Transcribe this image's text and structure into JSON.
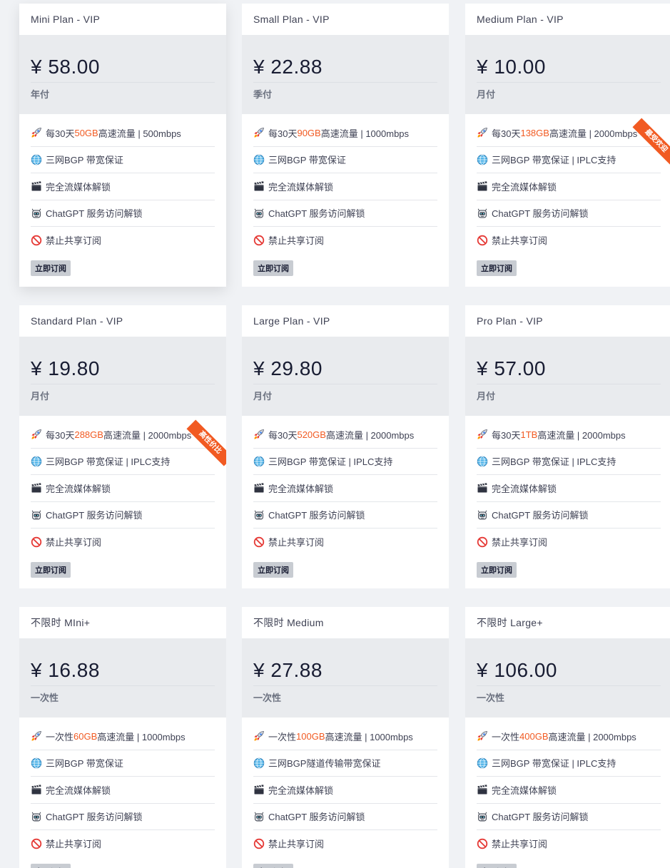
{
  "feature_icons": [
    "rocket-icon",
    "globe-icon",
    "clapper-icon",
    "robot-icon",
    "prohibited-icon"
  ],
  "subscribe_label": "立即订阅",
  "plans": [
    {
      "name": "Mini Plan - VIP",
      "price": "¥ 58.00",
      "period": "年付",
      "traffic": {
        "pre": "每30天",
        "hl": "50GB",
        "post": "高速流量 | 500mbps"
      },
      "features": [
        "三网BGP 带宽保证",
        "完全流媒体解锁",
        "ChatGPT 服务访问解锁",
        "禁止共享订阅"
      ]
    },
    {
      "name": "Small Plan - VIP",
      "price": "¥ 22.88",
      "period": "季付",
      "traffic": {
        "pre": "每30天",
        "hl": "90GB",
        "post": "高速流量 | 1000mbps"
      },
      "features": [
        "三网BGP 带宽保证",
        "完全流媒体解锁",
        "ChatGPT 服务访问解锁",
        "禁止共享订阅"
      ]
    },
    {
      "name": "Medium Plan - VIP",
      "price": "¥ 10.00",
      "period": "月付",
      "traffic": {
        "pre": "每30天",
        "hl": "138GB",
        "post": "高速流量 | 2000mbps"
      },
      "features": [
        "三网BGP 带宽保证 | IPLC支持",
        "完全流媒体解锁",
        "ChatGPT 服务访问解锁",
        "禁止共享订阅"
      ],
      "ribbon": "最受欢迎"
    },
    {
      "name": "Standard Plan - VIP",
      "price": "¥ 19.80",
      "period": "月付",
      "traffic": {
        "pre": "每30天",
        "hl": "288GB",
        "post": "高速流量 | 2000mbps"
      },
      "features": [
        "三网BGP 带宽保证 | IPLC支持",
        "完全流媒体解锁",
        "ChatGPT 服务访问解锁",
        "禁止共享订阅"
      ],
      "ribbon": "高性价比"
    },
    {
      "name": "Large Plan - VIP",
      "price": "¥ 29.80",
      "period": "月付",
      "traffic": {
        "pre": "每30天",
        "hl": "520GB",
        "post": "高速流量 | 2000mbps"
      },
      "features": [
        "三网BGP 带宽保证 | IPLC支持",
        "完全流媒体解锁",
        "ChatGPT 服务访问解锁",
        "禁止共享订阅"
      ]
    },
    {
      "name": "Pro Plan - VIP",
      "price": "¥ 57.00",
      "period": "月付",
      "traffic": {
        "pre": "每30天",
        "hl": "1TB",
        "post": "高速流量 | 2000mbps"
      },
      "features": [
        "三网BGP 带宽保证 | IPLC支持",
        "完全流媒体解锁",
        "ChatGPT 服务访问解锁",
        "禁止共享订阅"
      ]
    },
    {
      "name": "不限时 MIni+",
      "price": "¥ 16.88",
      "period": "一次性",
      "traffic": {
        "pre": "一次性",
        "hl": "60GB",
        "post": "高速流量 | 1000mbps"
      },
      "features": [
        "三网BGP 带宽保证",
        "完全流媒体解锁",
        "ChatGPT 服务访问解锁",
        "禁止共享订阅"
      ]
    },
    {
      "name": "不限时 Medium",
      "price": "¥ 27.88",
      "period": "一次性",
      "traffic": {
        "pre": "一次性",
        "hl": "100GB",
        "post": "高速流量 | 1000mbps"
      },
      "features": [
        "三网BGP隧道传输带宽保证",
        "完全流媒体解锁",
        "ChatGPT 服务访问解锁",
        "禁止共享订阅"
      ]
    },
    {
      "name": "不限时 Large+",
      "price": "¥ 106.00",
      "period": "一次性",
      "traffic": {
        "pre": "一次性",
        "hl": "400GB",
        "post": "高速流量 | 2000mbps"
      },
      "features": [
        "三网BGP 带宽保证 | IPLC支持",
        "完全流媒体解锁",
        "ChatGPT 服务访问解锁",
        "禁止共享订阅"
      ]
    }
  ]
}
